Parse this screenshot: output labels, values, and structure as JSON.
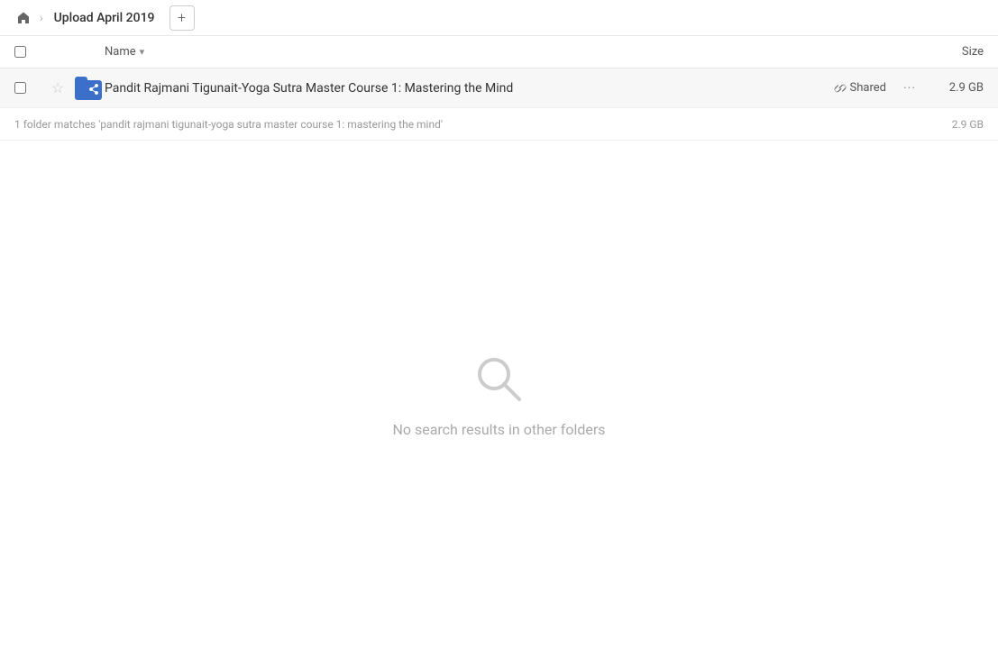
{
  "breadcrumb": {
    "home_icon": "🏠",
    "folder_name": "Upload April 2019",
    "add_icon": "+"
  },
  "columns": {
    "name_label": "Name",
    "sort_arrow": "▾",
    "size_label": "Size"
  },
  "file_row": {
    "folder_name": "Pandit Rajmani Tigunait-Yoga Sutra Master Course 1: Mastering the Mind",
    "shared_label": "Shared",
    "size": "2.9 GB",
    "more_icon": "···"
  },
  "matches_info": {
    "text": "1 folder matches 'pandit rajmani tigunait-yoga sutra master course 1: mastering the mind'",
    "size": "2.9 GB"
  },
  "empty_state": {
    "message": "No search results in other folders"
  }
}
